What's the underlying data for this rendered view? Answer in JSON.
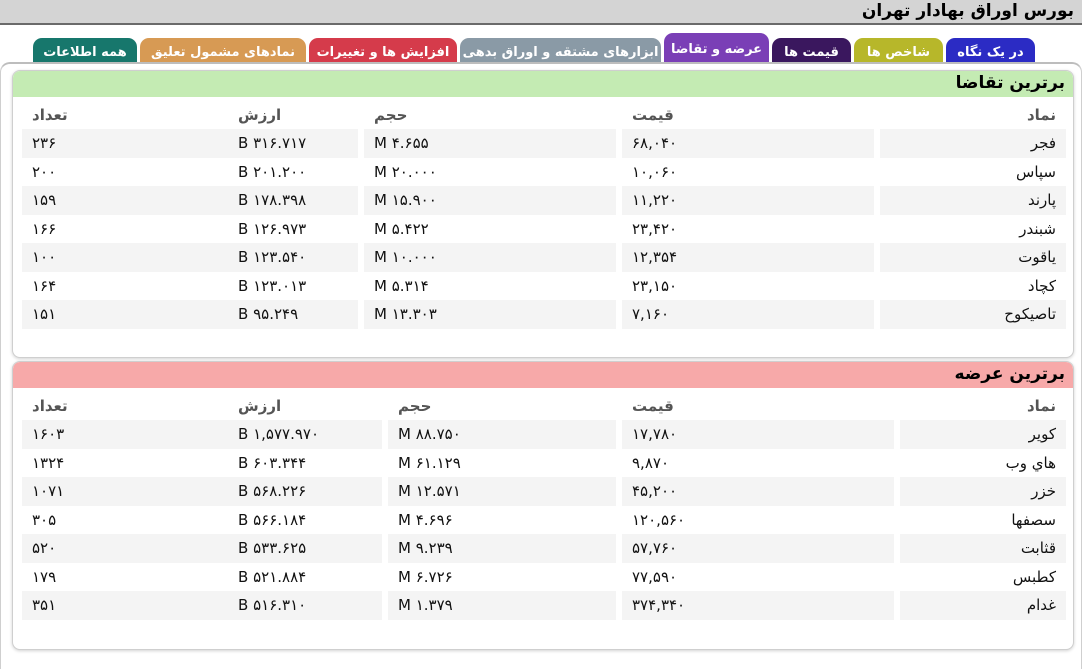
{
  "window": {
    "title": "بورس اوراق بهادار تهران"
  },
  "tabs": [
    {
      "label": "در یک نگاه",
      "color": "#2b2bc4",
      "active": false
    },
    {
      "label": "شاخص ها",
      "color": "#b7b72a",
      "active": false
    },
    {
      "label": "قیمت ها",
      "color": "#3a175e",
      "active": false
    },
    {
      "label": "عرضه و تقاضا",
      "color": "#7a3fb6",
      "active": true
    },
    {
      "label": "ابزارهای مشتقه و اوراق بدهی",
      "color": "#8a9aa6",
      "active": false
    },
    {
      "label": "افزایش ها و تغییرات",
      "color": "#d53b4b",
      "active": false
    },
    {
      "label": "نمادهای مشمول تعلیق",
      "color": "#d79a54",
      "active": false
    },
    {
      "label": "همه اطلاعات",
      "color": "#17776c",
      "active": false
    }
  ],
  "demand": {
    "title": "برترین تقاضا",
    "header_color": "#c4ebb3",
    "columns": {
      "symbol": "نماد",
      "price": "قیمت",
      "volume": "حجم",
      "value": "ارزش",
      "count": "تعداد"
    },
    "rows": [
      {
        "symbol": "فجر",
        "price": "۶۸,۰۴۰",
        "volume": "۴.۶۵۵ M",
        "value": "۳۱۶.۷۱۷ B",
        "count": "۲۳۶"
      },
      {
        "symbol": "سپاس",
        "price": "۱۰,۰۶۰",
        "volume": "۲۰.۰۰۰ M",
        "value": "۲۰۱.۲۰۰ B",
        "count": "۲۰۰"
      },
      {
        "symbol": "پارند",
        "price": "۱۱,۲۲۰",
        "volume": "۱۵.۹۰۰ M",
        "value": "۱۷۸.۳۹۸ B",
        "count": "۱۵۹"
      },
      {
        "symbol": "شبندر",
        "price": "۲۳,۴۲۰",
        "volume": "۵.۴۲۲ M",
        "value": "۱۲۶.۹۷۳ B",
        "count": "۱۶۶"
      },
      {
        "symbol": "یاقوت",
        "price": "۱۲,۳۵۴",
        "volume": "۱۰.۰۰۰ M",
        "value": "۱۲۳.۵۴۰ B",
        "count": "۱۰۰"
      },
      {
        "symbol": "کچاد",
        "price": "۲۳,۱۵۰",
        "volume": "۵.۳۱۴ M",
        "value": "۱۲۳.۰۱۳ B",
        "count": "۱۶۴"
      },
      {
        "symbol": "تاصیکوح",
        "price": "۷,۱۶۰",
        "volume": "۱۳.۳۰۳ M",
        "value": "۹۵.۲۴۹ B",
        "count": "۱۵۱"
      }
    ]
  },
  "supply": {
    "title": "برترین عرضه",
    "header_color": "#f7a9a9",
    "columns": {
      "symbol": "نماد",
      "price": "قیمت",
      "volume": "حجم",
      "value": "ارزش",
      "count": "تعداد"
    },
    "rows": [
      {
        "symbol": "کویر",
        "price": "۱۷,۷۸۰",
        "volume": "۸۸.۷۵۰ M",
        "value": "۱,۵۷۷.۹۷۰ B",
        "count": "۱۶۰۳"
      },
      {
        "symbol": "هاي وب",
        "price": "۹,۸۷۰",
        "volume": "۶۱.۱۲۹ M",
        "value": "۶۰۳.۳۴۴ B",
        "count": "۱۳۲۴"
      },
      {
        "symbol": "خزر",
        "price": "۴۵,۲۰۰",
        "volume": "۱۲.۵۷۱ M",
        "value": "۵۶۸.۲۲۶ B",
        "count": "۱۰۷۱"
      },
      {
        "symbol": "سصفها",
        "price": "۱۲۰,۵۶۰",
        "volume": "۴.۶۹۶ M",
        "value": "۵۶۶.۱۸۴ B",
        "count": "۳۰۵"
      },
      {
        "symbol": "قثابت",
        "price": "۵۷,۷۶۰",
        "volume": "۹.۲۳۹ M",
        "value": "۵۳۳.۶۲۵ B",
        "count": "۵۲۰"
      },
      {
        "symbol": "کطبس",
        "price": "۷۷,۵۹۰",
        "volume": "۶.۷۲۶ M",
        "value": "۵۲۱.۸۸۴ B",
        "count": "۱۷۹"
      },
      {
        "symbol": "غدام",
        "price": "۳۷۴,۳۴۰",
        "volume": "۱.۳۷۹ M",
        "value": "۵۱۶.۳۱۰ B",
        "count": "۳۵۱"
      }
    ]
  }
}
